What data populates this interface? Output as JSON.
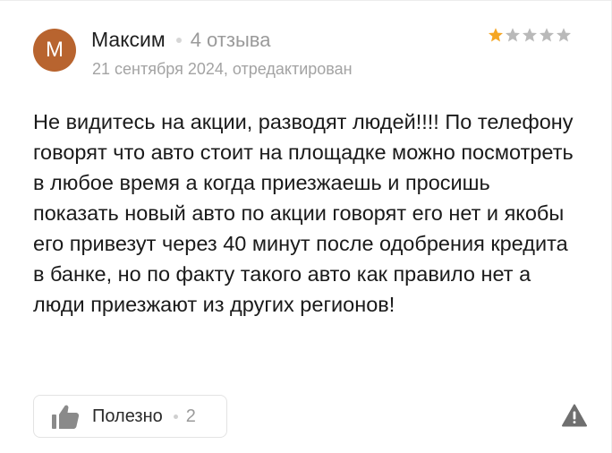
{
  "review": {
    "avatar_letter": "М",
    "avatar_color": "#b8642f",
    "author_name": "Максим",
    "author_reviews": "4 отзыва",
    "date": "21 сентября 2024, отредактирован",
    "rating": 1,
    "rating_max": 5,
    "star_filled_color": "#f5a623",
    "star_empty_color": "#b9b9b9",
    "text": "Не видитесь на акции, разводят людей!!!! По телефону говорят что авто стоит на площадке можно посмотреть в любое время а когда приезжаешь и просишь показать новый авто по акции говорят его нет и якобы его привезут через 40 минут после одобрения кредита в банке, но по факту такого авто как правило нет а люди приезжают из других регионов!"
  },
  "actions": {
    "useful_label": "Полезно",
    "useful_count": "2",
    "thumb_icon": "thumbs-up-icon",
    "report_icon": "warning-icon"
  }
}
